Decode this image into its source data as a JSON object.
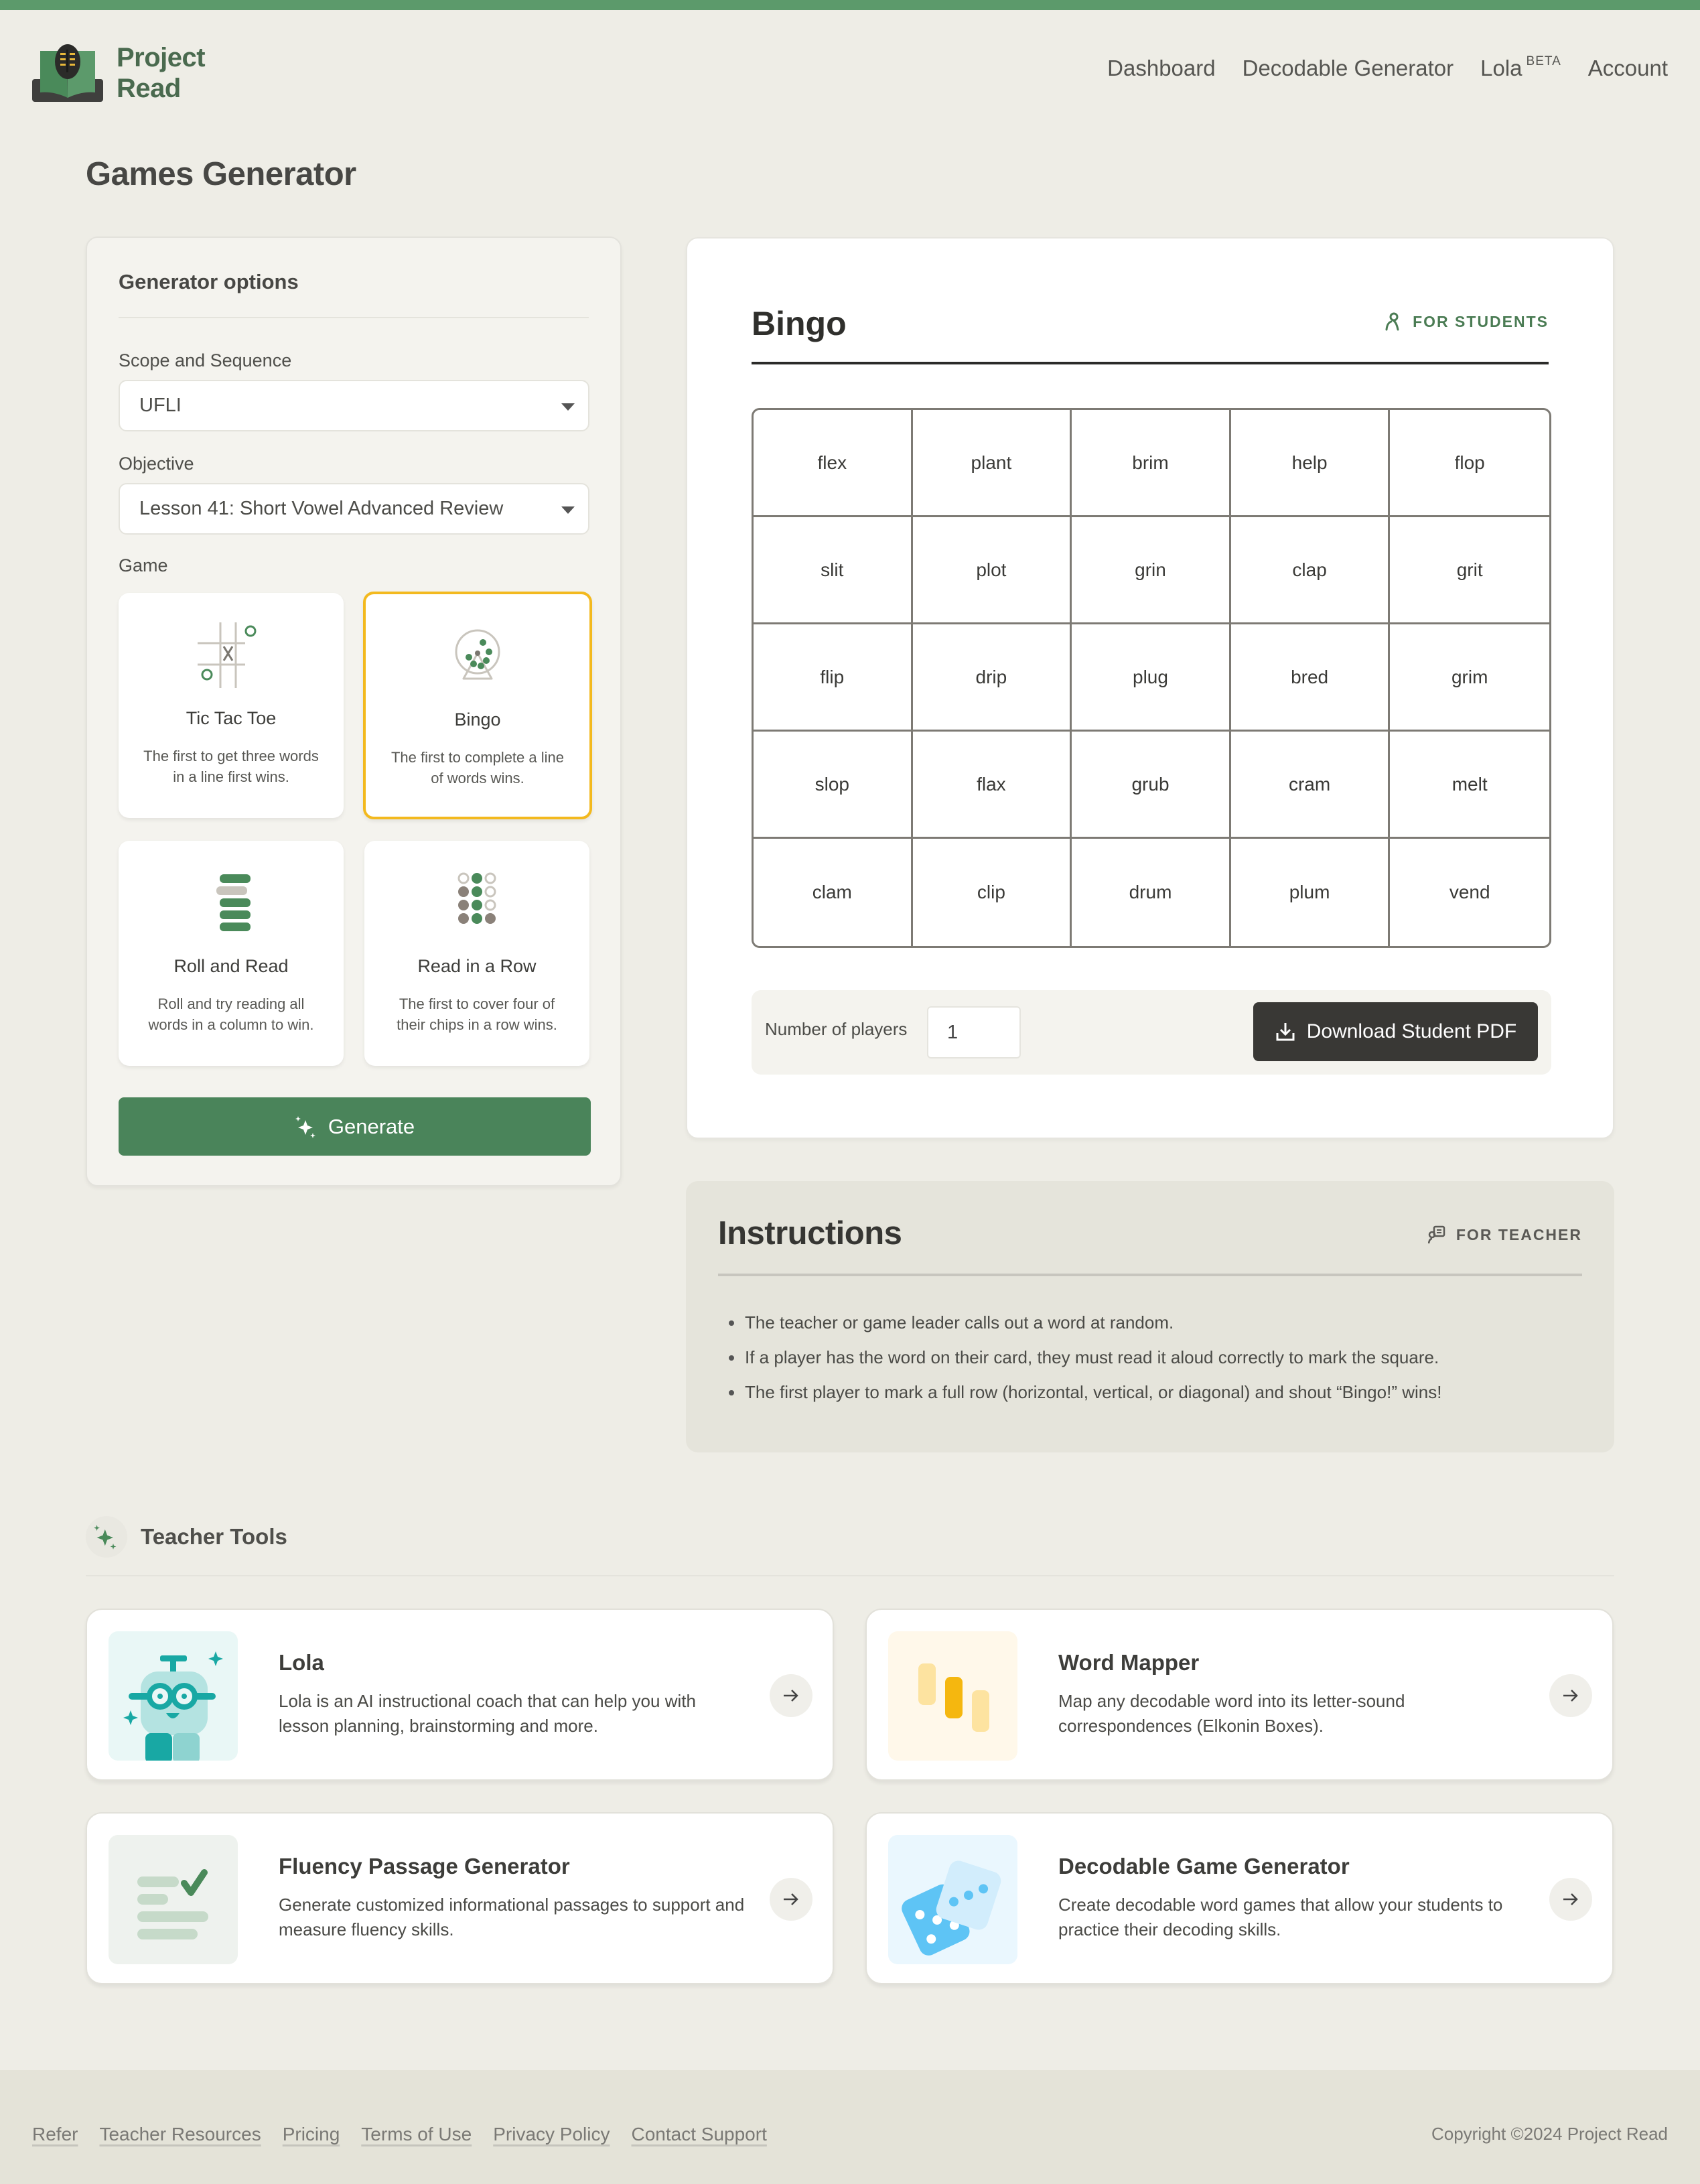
{
  "brand": {
    "name_line1": "Project",
    "name_line2": "Read",
    "accent_color": "#5c9a6b"
  },
  "nav": {
    "items": [
      {
        "label": "Dashboard"
      },
      {
        "label": "Decodable Generator"
      },
      {
        "label": "Lola",
        "badge": "BETA"
      },
      {
        "label": "Account"
      }
    ]
  },
  "page": {
    "title": "Games Generator"
  },
  "generator_options": {
    "title": "Generator options",
    "scope_label": "Scope and Sequence",
    "scope_value": "UFLI",
    "objective_label": "Objective",
    "objective_value": "Lesson 41: Short Vowel Advanced Review",
    "game_label": "Game",
    "games": [
      {
        "name": "Tic Tac Toe",
        "desc": "The first to get three words in a line first wins.",
        "icon": "tic-tac-toe-icon",
        "selected": false
      },
      {
        "name": "Bingo",
        "desc": "The first to complete a line of words wins.",
        "icon": "bingo-cage-icon",
        "selected": true
      },
      {
        "name": "Roll and Read",
        "desc": "Roll and try reading all words in a column to win.",
        "icon": "stacked-bars-icon",
        "selected": false
      },
      {
        "name": "Read in a Row",
        "desc": "The first to cover four of their chips in a row wins.",
        "icon": "chips-grid-icon",
        "selected": false
      }
    ],
    "generate_label": "Generate"
  },
  "bingo": {
    "title": "Bingo",
    "audience": "FOR STUDENTS",
    "grid": [
      [
        "flex",
        "plant",
        "brim",
        "help",
        "flop"
      ],
      [
        "slit",
        "plot",
        "grin",
        "clap",
        "grit"
      ],
      [
        "flip",
        "drip",
        "plug",
        "bred",
        "grim"
      ],
      [
        "slop",
        "flax",
        "grub",
        "cram",
        "melt"
      ],
      [
        "clam",
        "clip",
        "drum",
        "plum",
        "vend"
      ]
    ],
    "players_label": "Number of players",
    "players_value": "1",
    "download_label": "Download Student PDF"
  },
  "instructions": {
    "title": "Instructions",
    "audience": "FOR TEACHER",
    "items": [
      "The teacher or game leader calls out a word at random.",
      "If a player has the word on their card, they must read it aloud correctly to mark the square.",
      "The first player to mark a full row (horizontal, vertical, or diagonal) and shout “Bingo!” wins!"
    ]
  },
  "teacher_tools": {
    "title": "Teacher Tools",
    "tools": [
      {
        "name": "Lola",
        "desc": "Lola is an AI instructional coach that can help you with lesson planning, brainstorming and more."
      },
      {
        "name": "Word Mapper",
        "desc": "Map any decodable word into its letter-sound correspondences (Elkonin Boxes)."
      },
      {
        "name": "Fluency Passage Generator",
        "desc": "Generate customized informational passages to support and measure fluency skills."
      },
      {
        "name": "Decodable Game Generator",
        "desc": "Create decodable word games that allow your students to practice their decoding skills."
      }
    ]
  },
  "footer": {
    "links": [
      "Refer",
      "Teacher Resources",
      "Pricing",
      "Terms of Use",
      "Privacy Policy",
      "Contact Support"
    ],
    "copyright": "Copyright ©2024 Project Read"
  }
}
